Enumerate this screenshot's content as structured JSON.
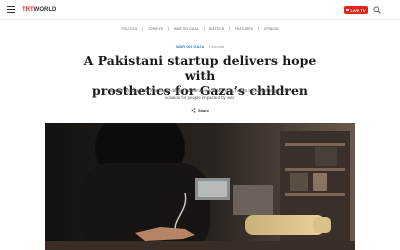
{
  "header": {
    "logo_mark": "TRT",
    "logo_text": "WORLD",
    "live_label": "LIVE TV"
  },
  "nav": {
    "items": [
      "POLITICS",
      "TÜRKİYE",
      "WAR ON GAZA",
      "BIZTECH",
      "FEATURES",
      "OPINION"
    ]
  },
  "article": {
    "category": "WAR ON GAZA",
    "time": "1 min read",
    "headline_line1": "A Pakistani startup delivers hope with",
    "headline_line2": "prosthetics for Gaza’s children",
    "summary_line1": "Bionikz uses remote imaging to design custom arms at low cost, hopes to pioneer large-scale",
    "summary_line2": "solution for people impacted by war.",
    "share_label": "Share"
  },
  "colors": {
    "brand_red": "#e1251b",
    "category_blue": "#2a7fc9"
  },
  "icons": {
    "menu": "hamburger-menu-icon",
    "search": "search-icon",
    "share": "share-icon"
  }
}
